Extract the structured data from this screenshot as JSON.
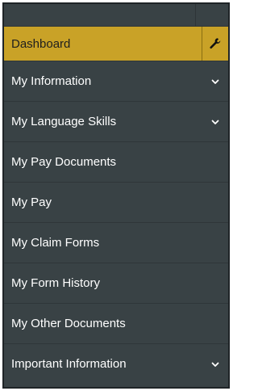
{
  "menu": {
    "items": [
      {
        "label": "Dashboard",
        "icon": "wrench-icon",
        "active": true
      },
      {
        "label": "My Information",
        "icon": "chevron-down-icon"
      },
      {
        "label": "My Language Skills",
        "icon": "chevron-down-icon"
      },
      {
        "label": "My Pay Documents"
      },
      {
        "label": "My Pay"
      },
      {
        "label": "My Claim Forms"
      },
      {
        "label": "My Form History"
      },
      {
        "label": "My Other Documents"
      },
      {
        "label": "Important Information",
        "icon": "chevron-down-icon"
      }
    ]
  },
  "colors": {
    "sidebar_bg": "#394245",
    "active_bg": "#c9a227",
    "text": "#ffffff",
    "active_text": "#1e1e1e"
  }
}
